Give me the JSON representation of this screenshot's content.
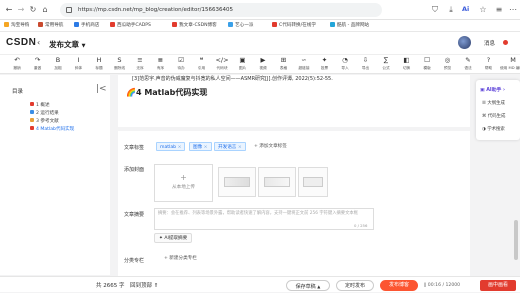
{
  "browser": {
    "url": "https://mp.csdn.net/mp_blog/creation/editor/156636405",
    "ai_label": "Ai"
  },
  "bookmarks": [
    {
      "label": "淘宝导购",
      "color": "#f5a623"
    },
    {
      "label": "常用导航",
      "color": "#c94a2f"
    },
    {
      "label": "手机商店",
      "color": "#2d7be5"
    },
    {
      "label": "西瓜助手CADPS",
      "color": "#e23b2e"
    },
    {
      "label": "我文章-CSDN博客",
      "color": "#e23b2e"
    },
    {
      "label": "艺心一派",
      "color": "#3aa0e8"
    },
    {
      "label": "C代码转换/在线学",
      "color": "#e23b2e"
    },
    {
      "label": "酷航 - 品牌网站",
      "color": "#22a5d8"
    }
  ],
  "header": {
    "logo": "CSDN",
    "title": "发布文章",
    "user_label": "消息"
  },
  "toolbar": [
    {
      "icon": "↶",
      "label": "撤销",
      "name": "undo-button"
    },
    {
      "icon": "↷",
      "label": "重做",
      "name": "redo-button"
    },
    {
      "icon": "B",
      "label": "加粗",
      "name": "bold-button"
    },
    {
      "icon": "I",
      "label": "斜体",
      "name": "italic-button"
    },
    {
      "icon": "H",
      "label": "标题",
      "name": "heading-button"
    },
    {
      "icon": "S",
      "label": "删除线",
      "name": "strike-button"
    },
    {
      "icon": "≡",
      "label": "无序",
      "name": "ul-button"
    },
    {
      "icon": "≣",
      "label": "有序",
      "name": "ol-button"
    },
    {
      "icon": "☑",
      "label": "待办",
      "name": "todo-button"
    },
    {
      "icon": "❝",
      "label": "引用",
      "name": "quote-button"
    },
    {
      "icon": "</>",
      "label": "代码块",
      "name": "code-button"
    },
    {
      "icon": "▣",
      "label": "图片",
      "name": "image-button"
    },
    {
      "icon": "▶",
      "label": "视频",
      "name": "video-button"
    },
    {
      "icon": "⊞",
      "label": "表格",
      "name": "table-button"
    },
    {
      "icon": "∽",
      "label": "超链接",
      "name": "link-button"
    },
    {
      "icon": "✦",
      "label": "投票",
      "name": "vote-button"
    },
    {
      "icon": "◔",
      "label": "导入",
      "name": "import-button"
    },
    {
      "icon": "⇩",
      "label": "导出",
      "name": "export-button"
    },
    {
      "icon": "∑",
      "label": "公式",
      "name": "formula-button"
    },
    {
      "icon": "◧",
      "label": "切换",
      "name": "switch-button"
    },
    {
      "icon": "☐",
      "label": "模版",
      "name": "template-button"
    },
    {
      "icon": "◎",
      "label": "预览",
      "name": "preview-button"
    },
    {
      "icon": "✎",
      "label": "语法",
      "name": "syntax-button"
    },
    {
      "icon": "?",
      "label": "帮助",
      "name": "help-button"
    },
    {
      "icon": "M",
      "label": "使用 MD 编辑器",
      "name": "md-editor-button"
    }
  ],
  "sidebar": {
    "title": "目录",
    "items": [
      {
        "label": "1 概述",
        "color": "#e23b2e"
      },
      {
        "label": "2 运行结果",
        "color": "#3a8ee6"
      },
      {
        "label": "3 参考文献",
        "color": "#e8a13a"
      },
      {
        "label": "4 Matlab代码实现",
        "color": "#e23b2e",
        "active": true
      }
    ]
  },
  "doc": {
    "reference_text": "[3]范思宇.声音的伪威魔复与抖宽的私人空间——ASMR研究[J].创作评谭, 2022(5):52-55.",
    "heading": "4 Matlab代码实现"
  },
  "form": {
    "tags_label": "文章标签",
    "tags": [
      "matlab",
      "图像",
      "开发语言"
    ],
    "add_tag": "+ 添加文章标签",
    "cover_label": "添加封面",
    "upload_label": "从本地上传",
    "summary_label": "文章摘要",
    "summary_placeholder": "摘要：会在推荐、列表等场景外露，帮助读者快速了解内容，支持一键将正文前 256 字符键入摘要文本框",
    "summary_counter": "0 / 256",
    "ai_summary": "AI提取摘要",
    "category_label": "分类专栏",
    "new_category": "+ 新建分类专栏"
  },
  "ai_panel": {
    "title": "AI助手",
    "items": [
      "大纲生成",
      "代码生成",
      "学术搜索"
    ]
  },
  "bottom": {
    "word_count": "共 2665 字",
    "back_to_top": "回到顶部",
    "save_draft": "保存草稿",
    "scheduled": "定时发布",
    "publish": "发布博客",
    "progress": "00:16 / 12000",
    "pip": "画中画看"
  }
}
